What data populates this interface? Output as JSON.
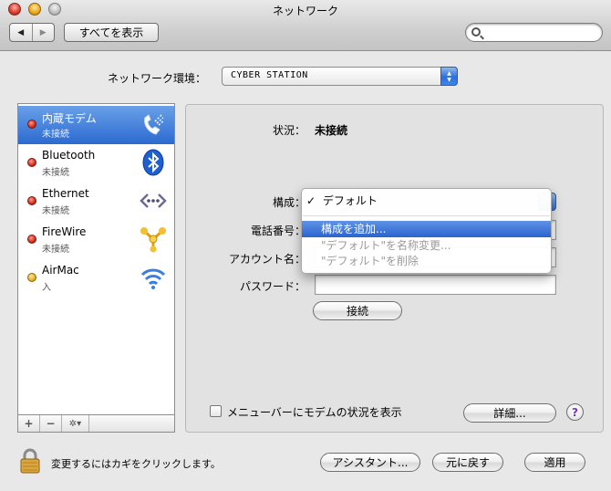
{
  "window": {
    "title": "ネットワーク"
  },
  "toolbar": {
    "back_symbol": "◀",
    "forward_symbol": "▶",
    "show_all": "すべてを表示",
    "search_placeholder": ""
  },
  "location": {
    "label": "ネットワーク環境：",
    "value": "CYBER STATION"
  },
  "services": [
    {
      "name": "内蔵モデム",
      "status": "未接続",
      "status_color": "red",
      "icon": "modem-icon",
      "selected": true
    },
    {
      "name": "Bluetooth",
      "status": "未接続",
      "status_color": "red",
      "icon": "bluetooth-icon",
      "selected": false
    },
    {
      "name": "Ethernet",
      "status": "未接続",
      "status_color": "red",
      "icon": "ethernet-icon",
      "selected": false
    },
    {
      "name": "FireWire",
      "status": "未接続",
      "status_color": "red",
      "icon": "firewire-icon",
      "selected": false
    },
    {
      "name": "AirMac",
      "status": "入",
      "status_color": "amber",
      "icon": "airport-icon",
      "selected": false
    }
  ],
  "list_toolbar": {
    "add": "+",
    "remove": "−",
    "gear": "✲▾"
  },
  "detail": {
    "status_label": "状況：",
    "status_value": "未接続",
    "config_label": "構成：",
    "phone_label": "電話番号：",
    "account_label": "アカウント名：",
    "password_label": "パスワード：",
    "connect_button": "接続"
  },
  "config_menu": {
    "checkmark": "✓",
    "items": [
      {
        "label": "デフォルト",
        "checked": true,
        "state": "normal"
      },
      {
        "label": "構成を追加...",
        "checked": false,
        "state": "highlighted"
      },
      {
        "label": "\"デフォルト\"を名称変更...",
        "checked": false,
        "state": "disabled"
      },
      {
        "label": "\"デフォルト\"を削除",
        "checked": false,
        "state": "disabled"
      }
    ]
  },
  "menubar_checkbox": {
    "label": "メニューバーにモデムの状況を表示",
    "checked": false
  },
  "advanced_button": "詳細...",
  "help_button": "?",
  "footer": {
    "lock_text": "変更するにはカギをクリックします。",
    "assistant_button": "アシスタント...",
    "revert_button": "元に戻す",
    "apply_button": "適用"
  },
  "colors": {
    "selection": "#2b6ad0",
    "status_red": "#d82a1c",
    "status_amber": "#e8b020",
    "help_purple": "#6a3ab8"
  }
}
